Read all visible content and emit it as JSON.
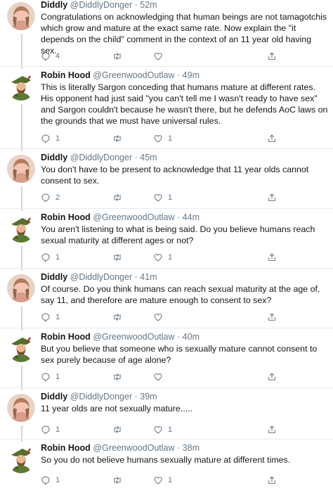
{
  "tweets": [
    {
      "author": "Diddly",
      "handle": "@DiddlyDonger",
      "time": "52m",
      "text": "Congratulations on acknowledging that human beings are not tamagotchis which grow and mature at the exact same rate. Now explain the \"it depends on the child\" comment in the context of an 11 year old having sex.",
      "replies": "4",
      "retweets": "",
      "likes": "",
      "avatar": "diddly-avatar"
    },
    {
      "author": "Robin Hood",
      "handle": "@GreenwoodOutlaw",
      "time": "49m",
      "text": "This is literally Sargon conceding that humans mature at different rates. His opponent had just said \"you can't tell me I wasn't ready to have sex\" and Sargon couldn't because he wasn't there, but he defends AoC laws on the grounds that we must have universal rules.",
      "replies": "1",
      "retweets": "",
      "likes": "1",
      "avatar": "robin-hood-avatar"
    },
    {
      "author": "Diddly",
      "handle": "@DiddlyDonger",
      "time": "45m",
      "text": "You don't have to be present to acknowledge that 11 year olds cannot consent to sex.",
      "replies": "2",
      "retweets": "",
      "likes": "1",
      "avatar": "diddly-avatar"
    },
    {
      "author": "Robin Hood",
      "handle": "@GreenwoodOutlaw",
      "time": "44m",
      "text": "You aren't listening to what is being said. Do you believe humans reach sexual maturity at different ages or not?",
      "replies": "1",
      "retweets": "",
      "likes": "1",
      "avatar": "robin-hood-avatar"
    },
    {
      "author": "Diddly",
      "handle": "@DiddlyDonger",
      "time": "41m",
      "text": "Of course. Do you think humans can reach sexual maturity at the age of, say 11, and therefore are mature enough to consent to sex?",
      "replies": "1",
      "retweets": "",
      "likes": "",
      "avatar": "diddly-avatar"
    },
    {
      "author": "Robin Hood",
      "handle": "@GreenwoodOutlaw",
      "time": "40m",
      "text": "But you believe that someone who is sexually mature cannot consent to sex purely because of age alone?",
      "replies": "1",
      "retweets": "",
      "likes": "",
      "avatar": "robin-hood-avatar"
    },
    {
      "author": "Diddly",
      "handle": "@DiddlyDonger",
      "time": "39m",
      "text": "11 year olds are not sexually mature.....",
      "replies": "1",
      "retweets": "",
      "likes": "1",
      "avatar": "diddly-avatar"
    },
    {
      "author": "Robin Hood",
      "handle": "@GreenwoodOutlaw",
      "time": "38m",
      "text": "So you do not believe humans sexually mature at different times.",
      "replies": "1",
      "retweets": "",
      "likes": "1",
      "avatar": "robin-hood-avatar"
    }
  ],
  "separator_dot": "·",
  "colors": {
    "text": "#14171a",
    "muted": "#657786",
    "divider": "#e6ecf0",
    "thread_line": "#ccd6dd"
  },
  "icons": {
    "reply": "reply-icon",
    "retweet": "retweet-icon",
    "like": "like-icon",
    "share": "share-icon"
  }
}
